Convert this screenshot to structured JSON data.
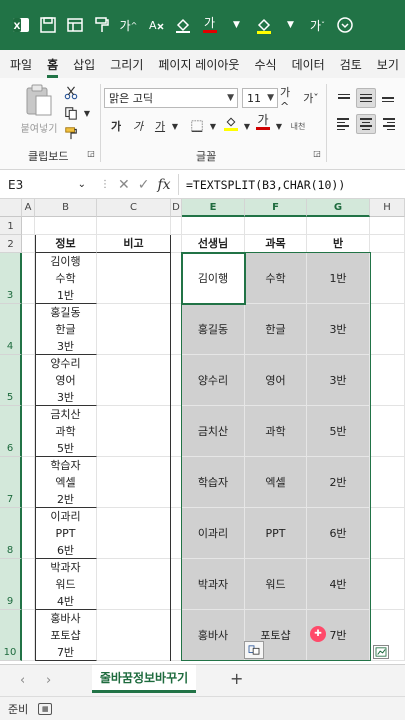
{
  "ribbon_tabs": [
    "파일",
    "홈",
    "삽입",
    "그리기",
    "페이지 레이아웃",
    "수식",
    "데이터",
    "검토",
    "보기"
  ],
  "ribbon": {
    "paste_label": "붙여넣기",
    "clipboard_label": "클립보드",
    "font_group_label": "글꼴",
    "font_name": "맑은 고딕",
    "font_size": "11",
    "grow_font": "가^",
    "shrink_font": "가ˇ",
    "bold": "가",
    "italic": "가",
    "underline": "가",
    "font_color_label": "가",
    "phonetic_label": "내천",
    "font_color": "#d00000",
    "fill_color": "#ffff00"
  },
  "formula_bar": {
    "name_box": "E3",
    "fx": "fx",
    "formula": "=TEXTSPLIT(B3,CHAR(10))"
  },
  "columns": [
    "A",
    "B",
    "C",
    "D",
    "E",
    "F",
    "G",
    "H"
  ],
  "rows": [
    "1",
    "2",
    "3",
    "4",
    "5",
    "6",
    "7",
    "8",
    "9",
    "10"
  ],
  "header_row": {
    "b": "정보",
    "c": "비고",
    "e": "선생님",
    "f": "과목",
    "g": "반"
  },
  "b_cells": [
    "김이행\n수학\n1반",
    "홍길동\n한글\n3반",
    "양수리\n영어\n3반",
    "금치산\n과학\n5반",
    "학습자\n엑셀\n2반",
    "이과리\nPPT\n6반",
    "박과자\n워드\n4반",
    "홍바사\n포토샵\n7반"
  ],
  "spill": [
    [
      "김이행",
      "수학",
      "1반"
    ],
    [
      "홍길동",
      "한글",
      "3반"
    ],
    [
      "양수리",
      "영어",
      "3반"
    ],
    [
      "금치산",
      "과학",
      "5반"
    ],
    [
      "학습자",
      "엑셀",
      "2반"
    ],
    [
      "이과리",
      "PPT",
      "6반"
    ],
    [
      "박과자",
      "워드",
      "4반"
    ],
    [
      "홍바사",
      "포토샵",
      "7반"
    ]
  ],
  "sheet_tab": "줄바꿈정보바꾸기",
  "add_sheet": "+",
  "status": "준비",
  "accent": "#217346"
}
